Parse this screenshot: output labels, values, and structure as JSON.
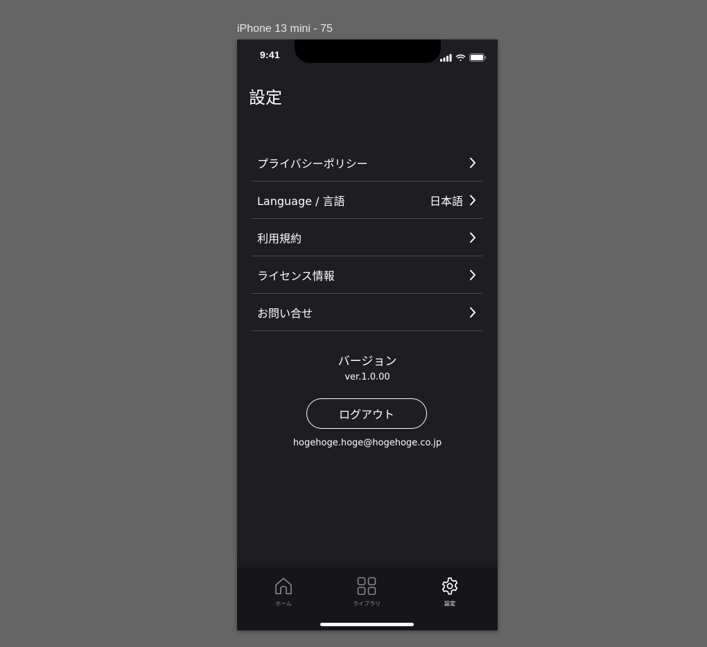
{
  "canvas": {
    "frame_label": "iPhone 13 mini - 75"
  },
  "status_bar": {
    "time": "9:41"
  },
  "header": {
    "title": "設定"
  },
  "menu": {
    "items": [
      {
        "label": "プライバシーポリシー",
        "value": ""
      },
      {
        "label": "Language / 言語",
        "value": "日本語"
      },
      {
        "label": "利用規約",
        "value": ""
      },
      {
        "label": "ライセンス情報",
        "value": ""
      },
      {
        "label": "お問い合せ",
        "value": ""
      }
    ]
  },
  "version": {
    "title": "バージョン",
    "value": "ver.1.0.00"
  },
  "account": {
    "logout_label": "ログアウト",
    "email": "hogehoge.hoge@hogehoge.co.jp"
  },
  "tabbar": {
    "tabs": [
      {
        "label": "ホーム",
        "icon": "home-icon",
        "active": false
      },
      {
        "label": "ライブラリ",
        "icon": "grid-icon",
        "active": false
      },
      {
        "label": "設定",
        "icon": "gear-icon",
        "active": true
      }
    ]
  },
  "colors": {
    "screen_background": "#1e1d22",
    "canvas_background": "#656565",
    "tabbar_background": "#161519",
    "divider": "#4a4a50",
    "text": "#ffffff",
    "inactive_tab": "#8a8a90"
  }
}
